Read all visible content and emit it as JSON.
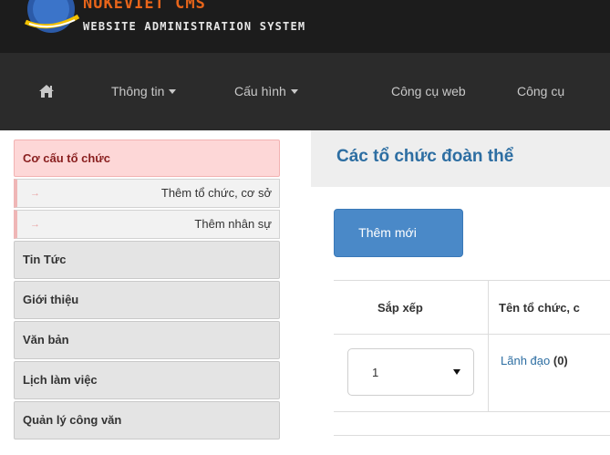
{
  "header": {
    "logo_text": "NUKEVIET CMS",
    "subtitle": "WEBSITE ADMINISTRATION SYSTEM"
  },
  "nav": {
    "home_icon": "home-icon",
    "items": [
      {
        "label": "Thông tin",
        "has_caret": true
      },
      {
        "label": "Cấu hình",
        "has_caret": true
      },
      {
        "label": "Công cụ web",
        "has_caret": false
      },
      {
        "label": "Công cụ",
        "has_caret": false
      }
    ]
  },
  "sidebar": {
    "active": "Cơ cấu tổ chức",
    "sub_items": [
      {
        "label": "Thêm tổ chức, cơ sở"
      },
      {
        "label": "Thêm nhân sự"
      }
    ],
    "items": [
      {
        "label": "Tin Tức"
      },
      {
        "label": "Giới thiệu"
      },
      {
        "label": "Văn bản"
      },
      {
        "label": "Lịch làm việc"
      },
      {
        "label": "Quản lý công văn"
      }
    ]
  },
  "main": {
    "title": "Các tổ chức đoàn thể",
    "add_button": "Thêm mới",
    "table": {
      "headers": [
        "Sắp xếp",
        "Tên tổ chức, c"
      ],
      "rows": [
        {
          "order": "1",
          "name": "Lãnh đạo",
          "count": "(0)"
        }
      ]
    }
  },
  "colors": {
    "accent": "#2d6ea2",
    "button": "#4a89c8",
    "active_sidebar_bg": "#fdd7d7",
    "nav_bg": "#2b2b2b"
  }
}
